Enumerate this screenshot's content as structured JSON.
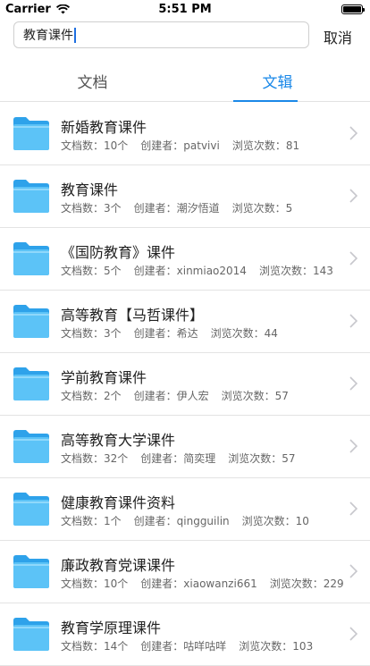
{
  "status": {
    "carrier": "Carrier",
    "time": "5:51 PM"
  },
  "search": {
    "value": "教育课件",
    "cancel_label": "取消"
  },
  "tabs": [
    {
      "label": "文档"
    },
    {
      "label": "文辑"
    }
  ],
  "list": [
    {
      "title": "新婚教育课件",
      "docs": "文档数：10个",
      "creator": "创建者：patvivi",
      "views": "浏览次数：81"
    },
    {
      "title": "教育课件",
      "docs": "文档数：3个",
      "creator": "创建者：潮汐悟道",
      "views": "浏览次数：5"
    },
    {
      "title": "《国防教育》课件",
      "docs": "文档数：5个",
      "creator": "创建者：xinmiao2014",
      "views": "浏览次数：143"
    },
    {
      "title": "高等教育【马哲课件】",
      "docs": "文档数：3个",
      "creator": "创建者：希达",
      "views": "浏览次数：44"
    },
    {
      "title": "学前教育课件",
      "docs": "文档数：2个",
      "creator": "创建者：伊人宏",
      "views": "浏览次数：57"
    },
    {
      "title": "高等教育大学课件",
      "docs": "文档数：32个",
      "creator": "创建者：简奕理",
      "views": "浏览次数：57"
    },
    {
      "title": "健康教育课件资料",
      "docs": "文档数：1个",
      "creator": "创建者：qingguilin",
      "views": "浏览次数：10"
    },
    {
      "title": "廉政教育党课课件",
      "docs": "文档数：10个",
      "creator": "创建者：xiaowanzi661",
      "views": "浏览次数：229"
    },
    {
      "title": "教育学原理课件",
      "docs": "文档数：14个",
      "creator": "创建者：咕咩咕咩",
      "views": "浏览次数：103"
    }
  ],
  "icons": {
    "folder": "folder-icon",
    "chevron": "chevron-right-icon",
    "wifi": "wifi-icon",
    "battery": "battery-icon"
  },
  "colors": {
    "accent": "#1a88e8",
    "folder": "#4fb8f5"
  }
}
